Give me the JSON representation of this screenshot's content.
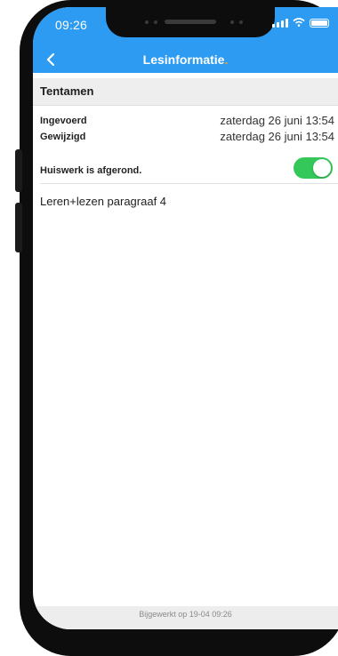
{
  "status_bar": {
    "time": "09:26"
  },
  "header": {
    "title": "Lesinformatie",
    "title_dot": "."
  },
  "section": {
    "title": "Tentamen"
  },
  "info": [
    {
      "label": "Ingevoerd",
      "value": "zaterdag 26 juni 13:54"
    },
    {
      "label": "Gewijzigd",
      "value": "zaterdag 26 juni 13:54"
    }
  ],
  "homework": {
    "label": "Huiswerk is afgerond.",
    "completed": true
  },
  "content": {
    "text": "Leren+lezen paragraaf 4"
  },
  "footer": {
    "text": "Bijgewerkt op 19-04 09:26"
  },
  "colors": {
    "header_blue": "#2c9bf1",
    "toggle_green": "#34c759",
    "accent_orange": "#f7a21b"
  }
}
